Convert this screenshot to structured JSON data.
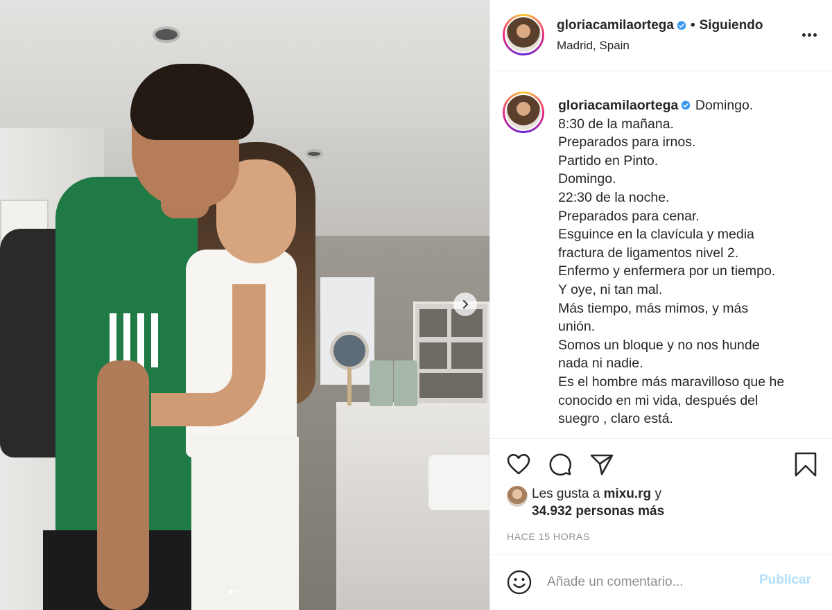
{
  "header": {
    "username": "gloriacamilaortega",
    "separator": "•",
    "follow_status": "Siguiendo",
    "location": "Madrid, Spain"
  },
  "caption": {
    "username": "gloriacamilaortega",
    "lines": [
      "Domingo.",
      "8:30 de la mañana.",
      "Preparados para irnos.",
      "Partido en Pinto.",
      "Domingo.",
      "22:30 de la noche.",
      "Preparados para cenar.",
      "Esguince en la clavícula y media",
      "fractura de ligamentos nivel 2.",
      "Enfermo y enfermera por un tiempo.",
      "Y oye, ni tan mal.",
      "Más tiempo, más mimos, y más",
      "unión.",
      "Somos un bloque y no nos hunde",
      "nada ni nadie.",
      "Es el hombre más maravilloso que he",
      "conocido en mi vida, después del",
      "suegro , claro está."
    ]
  },
  "likes": {
    "prefix": "Les gusta a",
    "user": "mixu.rg",
    "conj": "y",
    "count_text": "34.932 personas más"
  },
  "timestamp": "HACE 15 HORAS",
  "comment": {
    "placeholder": "Añade un comentario...",
    "publish_label": "Publicar"
  },
  "icons": {
    "like": "heart-icon",
    "comment": "comment-icon",
    "share": "share-icon",
    "save": "bookmark-icon",
    "more": "more-options-icon",
    "next": "chevron-right-icon",
    "emoji": "emoji-icon",
    "verified": "verified-badge-icon"
  },
  "colors": {
    "verified": "#3897f0",
    "publish_disabled": "#b2dffc",
    "text": "#262626",
    "muted": "#8e8e8e"
  },
  "carousel": {
    "slides": 2,
    "current": 1
  }
}
